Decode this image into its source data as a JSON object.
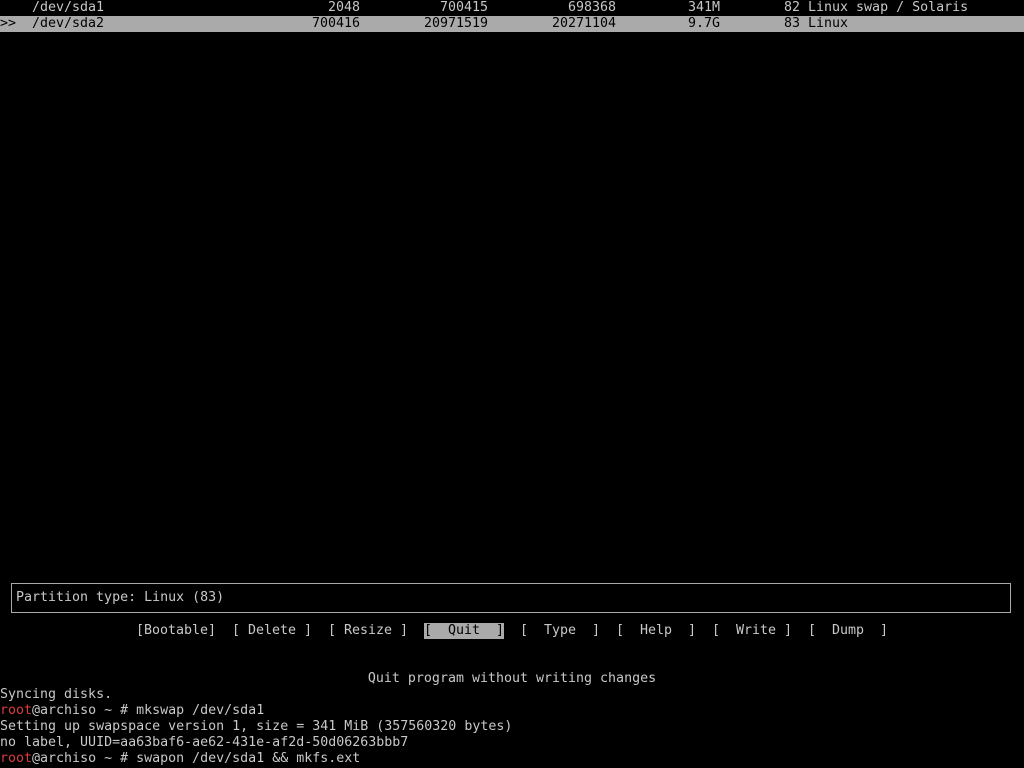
{
  "partitions": [
    {
      "marker": "",
      "device": "/dev/sda1",
      "start": "2048",
      "end": "700415",
      "sectors": "698368",
      "size": "341M",
      "type": "82 Linux swap / Solaris",
      "selected": false
    },
    {
      "marker": ">>",
      "device": "/dev/sda2",
      "start": "700416",
      "end": "20971519",
      "sectors": "20271104",
      "size": "9.7G",
      "type": "83 Linux",
      "selected": true
    }
  ],
  "info": {
    "partition_type": "Partition type: Linux (83)"
  },
  "menu": {
    "bootable": "[Bootable]",
    "delete": "[ Delete ]",
    "resize": "[ Resize ]",
    "quit": "[  Quit  ]",
    "type": "[  Type  ]",
    "help": "[  Help  ]",
    "write": "[  Write ]",
    "dump": "[  Dump  ]",
    "selected": "quit"
  },
  "hint": "Quit program without writing changes",
  "terminal": {
    "line1": "Syncing disks.",
    "prompt_user": "root",
    "prompt_rest": "@archiso ~ # ",
    "cmd1": "mkswap /dev/sda1",
    "line3": "Setting up swapspace version 1, size = 341 MiB (357560320 bytes)",
    "line4": "no label, UUID=aa63baf6-ae62-431e-af2d-50d06263bbb7",
    "cmd2": "swapon /dev/sda1 && mkfs.ext"
  },
  "colors": {
    "background": "#000000",
    "foreground": "#c8c8c8",
    "highlight_bg": "#aaaaaa",
    "prompt_user": "#d83c3c"
  }
}
